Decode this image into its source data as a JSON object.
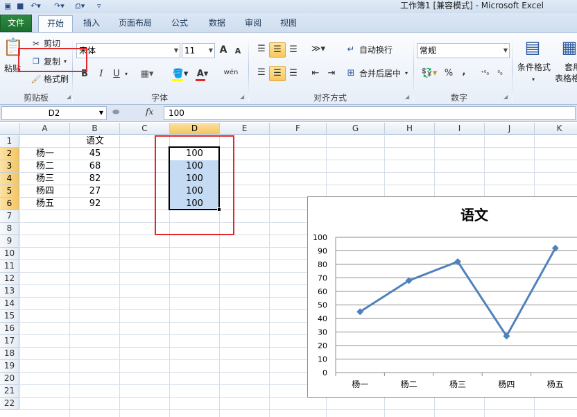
{
  "titlebar": {
    "title": "工作簿1  [兼容模式]  -  Microsoft Excel"
  },
  "tabs": [
    "文件",
    "开始",
    "插入",
    "页面布局",
    "公式",
    "数据",
    "审阅",
    "视图"
  ],
  "active_tab": "开始",
  "ribbon": {
    "clipboard": {
      "paste": "粘贴",
      "cut": "剪切",
      "copy": "复制",
      "format_painter": "格式刷",
      "group": "剪贴板"
    },
    "font": {
      "name": "宋体",
      "size": "11",
      "bold": "B",
      "italic": "I",
      "underline": "U",
      "grow": "A",
      "shrink": "A",
      "phonetic": "wén",
      "group": "字体"
    },
    "alignment": {
      "wrap": "自动换行",
      "merge": "合并后居中",
      "group": "对齐方式"
    },
    "number": {
      "format": "常规",
      "percent": "%",
      "comma": ",",
      "group": "数字"
    },
    "styles": {
      "conditional": "条件格式",
      "table": "套用",
      "table2": "表格格"
    }
  },
  "formula_bar": {
    "name_box": "D2",
    "fx": "fx",
    "value": "100"
  },
  "columns": [
    "A",
    "B",
    "C",
    "D",
    "E",
    "F",
    "G",
    "H",
    "I",
    "J",
    "K"
  ],
  "rows": [
    "1",
    "2",
    "3",
    "4",
    "5",
    "6",
    "7",
    "8",
    "9",
    "10",
    "11",
    "12",
    "13",
    "14",
    "15",
    "16",
    "17",
    "18",
    "19",
    "20",
    "21",
    "22"
  ],
  "cells": {
    "B1": "语文",
    "A2": "杨一",
    "B2": "45",
    "D2": "100",
    "A3": "杨二",
    "B3": "68",
    "D3": "100",
    "A4": "杨三",
    "B4": "82",
    "D4": "100",
    "A5": "杨四",
    "B5": "27",
    "D5": "100",
    "A6": "杨五",
    "B6": "92",
    "D6": "100"
  },
  "colors": {
    "line": "#4f81bd",
    "highlight": "#e02828",
    "selection": "#c5dbf4"
  },
  "chart_data": {
    "type": "line",
    "title": "语文",
    "categories": [
      "杨一",
      "杨二",
      "杨三",
      "杨四",
      "杨五"
    ],
    "series": [
      {
        "values": [
          45,
          68,
          82,
          27,
          92
        ]
      }
    ],
    "yticks": [
      "0",
      "10",
      "20",
      "30",
      "40",
      "50",
      "60",
      "70",
      "80",
      "90",
      "100"
    ],
    "ylim": [
      0,
      100
    ],
    "grid": true,
    "legend": "none"
  }
}
